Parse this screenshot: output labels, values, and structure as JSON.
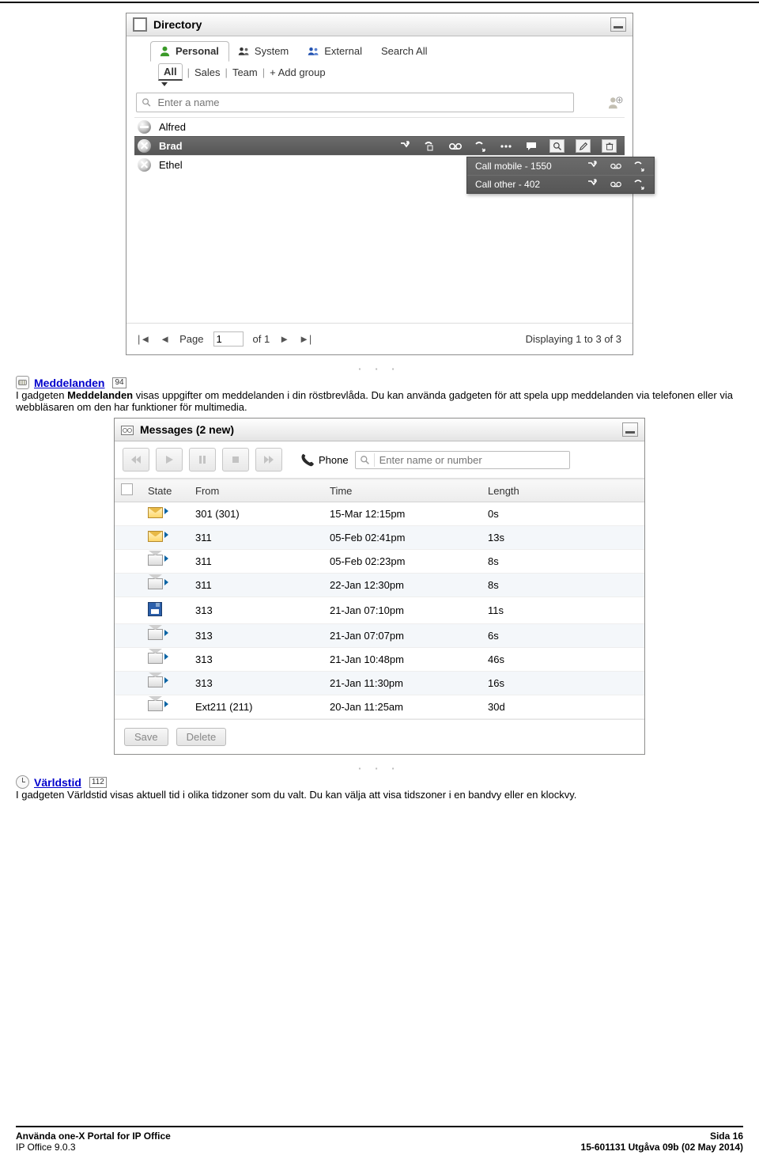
{
  "directory": {
    "title": "Directory",
    "tabs": [
      {
        "label": "Personal",
        "active": true,
        "icon": "person-green"
      },
      {
        "label": "System",
        "active": false,
        "icon": "people-dark"
      },
      {
        "label": "External",
        "active": false,
        "icon": "people-blue"
      },
      {
        "label": "Search All",
        "active": false,
        "icon": ""
      }
    ],
    "sub_tabs": {
      "all": "All",
      "sales": "Sales",
      "team": "Team",
      "add_group": "Add group"
    },
    "search_placeholder": "Enter a name",
    "contacts": [
      {
        "name": "Alfred",
        "status": "minus"
      },
      {
        "name": "Brad",
        "status": "x",
        "selected": true
      },
      {
        "name": "Ethel",
        "status": "x"
      }
    ],
    "popout": [
      {
        "text": "Call mobile - 1550"
      },
      {
        "text": "Call other - 402"
      }
    ],
    "pager": {
      "page_lbl": "Page",
      "page_val": "1",
      "of_lbl": "of 1",
      "display": "Displaying 1 to 3 of 3"
    }
  },
  "section_meddelanden": {
    "link": "Meddelanden",
    "badge": "94",
    "para": "I gadgeten Meddelanden visas uppgifter om meddelanden i din röstbrevlåda. Du kan använda gadgeten för att spela upp meddelanden via telefonen eller via webbläsaren om den har funktioner för multimedia."
  },
  "messages": {
    "title": "Messages (2 new)",
    "phone_label": "Phone",
    "search_placeholder": "Enter name or number",
    "columns": {
      "state": "State",
      "from": "From",
      "time": "Time",
      "length": "Length"
    },
    "rows": [
      {
        "state": "new",
        "from": "301 (301)",
        "time": "15-Mar 12:15pm",
        "length": "0s"
      },
      {
        "state": "new",
        "from": "311",
        "time": "05-Feb 02:41pm",
        "length": "13s"
      },
      {
        "state": "open",
        "from": "311",
        "time": "05-Feb 02:23pm",
        "length": "8s"
      },
      {
        "state": "open",
        "from": "311",
        "time": "22-Jan 12:30pm",
        "length": "8s"
      },
      {
        "state": "save",
        "from": "313",
        "time": "21-Jan 07:10pm",
        "length": "11s"
      },
      {
        "state": "open",
        "from": "313",
        "time": "21-Jan 07:07pm",
        "length": "6s"
      },
      {
        "state": "open",
        "from": "313",
        "time": "21-Jan 10:48pm",
        "length": "46s"
      },
      {
        "state": "open",
        "from": "313",
        "time": "21-Jan 11:30pm",
        "length": "16s"
      },
      {
        "state": "open",
        "from": "Ext211 (211)",
        "time": "20-Jan 11:25am",
        "length": "30d"
      }
    ],
    "buttons": {
      "save": "Save",
      "delete": "Delete"
    }
  },
  "section_varldstid": {
    "link": "Världstid",
    "badge": "112",
    "para": "I gadgeten Världstid visas aktuell tid i olika tidzoner som du valt. Du kan välja att visa tidszoner i en bandvy eller en klockvy."
  },
  "footer": {
    "l1": "Använda one-X Portal for IP Office",
    "l2": "IP Office 9.0.3",
    "r1": "Sida 16",
    "r2": "15-601131 Utgåva 09b (02 May 2014)"
  }
}
